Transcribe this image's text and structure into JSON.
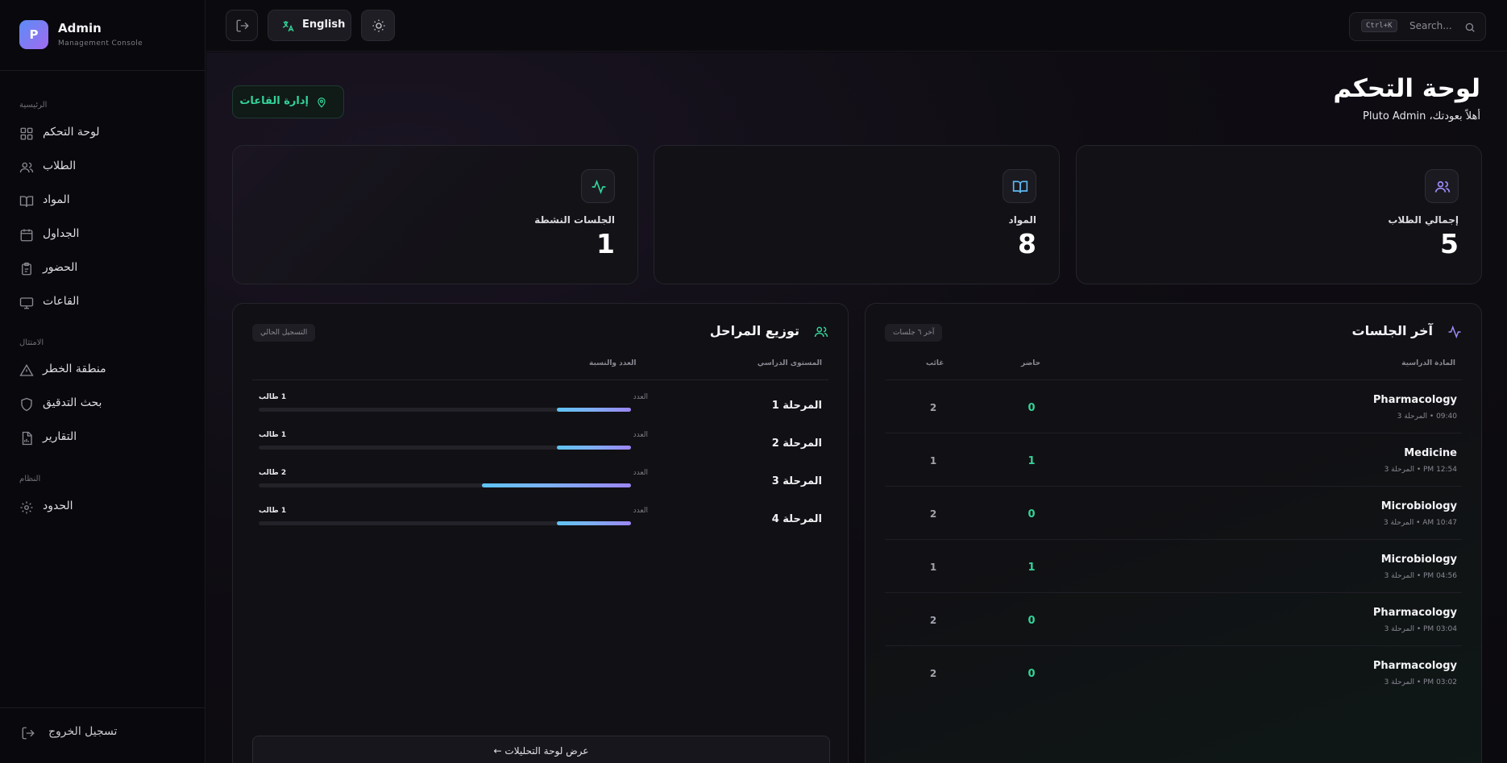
{
  "brand": {
    "logo_letter": "P",
    "title": "Admin",
    "subtitle": "Management Console"
  },
  "sidebar": {
    "sections": [
      "الرئيسية",
      "الامتثال",
      "النظام"
    ],
    "items": [
      {
        "label": "لوحة التحكم",
        "icon": "grid-icon"
      },
      {
        "label": "الطلاب",
        "icon": "users-icon"
      },
      {
        "label": "المواد",
        "icon": "book-icon"
      },
      {
        "label": "الجداول",
        "icon": "calendar-icon"
      },
      {
        "label": "الحضور",
        "icon": "clipboard-icon"
      },
      {
        "label": "القاعات",
        "icon": "monitor-icon"
      },
      {
        "label": "منطقة الخطر",
        "icon": "warning-icon"
      },
      {
        "label": "بحث التدقيق",
        "icon": "shield-icon"
      },
      {
        "label": "التقارير",
        "icon": "report-icon"
      },
      {
        "label": "الحدود",
        "icon": "gear-icon"
      }
    ],
    "logout_label": "تسجيل الخروج"
  },
  "topbar": {
    "language_label": "English",
    "search_placeholder": "Search...",
    "search_shortcut": "Ctrl+K"
  },
  "header": {
    "title": "لوحة التحكم",
    "welcome": "أهلاً بعودتك، Pluto Admin",
    "halls_button": "إدارة القاعات"
  },
  "stats": [
    {
      "label": "الجلسات النشطة",
      "value": "1",
      "icon": "activity-icon",
      "color": "#34d399"
    },
    {
      "label": "المواد",
      "value": "8",
      "icon": "book-open-icon",
      "color": "#5eb8f0"
    },
    {
      "label": "إجمالي الطلاب",
      "value": "5",
      "icon": "users-icon",
      "color": "#9b8cf5"
    }
  ],
  "stages_panel": {
    "title": "توزيع المراحل",
    "badge": "التسجيل الحالي",
    "col_level": "المستوى الدراسي",
    "col_count": "العدد والنسبة",
    "count_label": "العدد",
    "rows": [
      {
        "name": "المرحلة 1",
        "count_text": "1 طالب",
        "fraction": 0.2
      },
      {
        "name": "المرحلة 2",
        "count_text": "1 طالب",
        "fraction": 0.2
      },
      {
        "name": "المرحلة 3",
        "count_text": "2 طالب",
        "fraction": 0.4
      },
      {
        "name": "المرحلة 4",
        "count_text": "1 طالب",
        "fraction": 0.2
      }
    ],
    "analytics_button": "عرض لوحة التحليلات ←"
  },
  "sessions_panel": {
    "title": "آخر الجلسات",
    "badge": "آخر ٦ جلسات",
    "col_subject": "المادة الدراسية",
    "col_present": "حاضر",
    "col_absent": "غائب",
    "rows": [
      {
        "subject": "Pharmacology",
        "meta": "09:40 • المرحلة 3",
        "present": "0",
        "absent": "2"
      },
      {
        "subject": "Medicine",
        "meta": "12:54 PM • المرحلة 3",
        "present": "1",
        "absent": "1"
      },
      {
        "subject": "Microbiology",
        "meta": "10:47 AM • المرحلة 3",
        "present": "0",
        "absent": "2"
      },
      {
        "subject": "Microbiology",
        "meta": "04:56 PM • المرحلة 3",
        "present": "1",
        "absent": "1"
      },
      {
        "subject": "Pharmacology",
        "meta": "03:04 PM • المرحلة 3",
        "present": "0",
        "absent": "2"
      },
      {
        "subject": "Pharmacology",
        "meta": "03:02 PM • المرحلة 3",
        "present": "0",
        "absent": "2"
      }
    ]
  }
}
